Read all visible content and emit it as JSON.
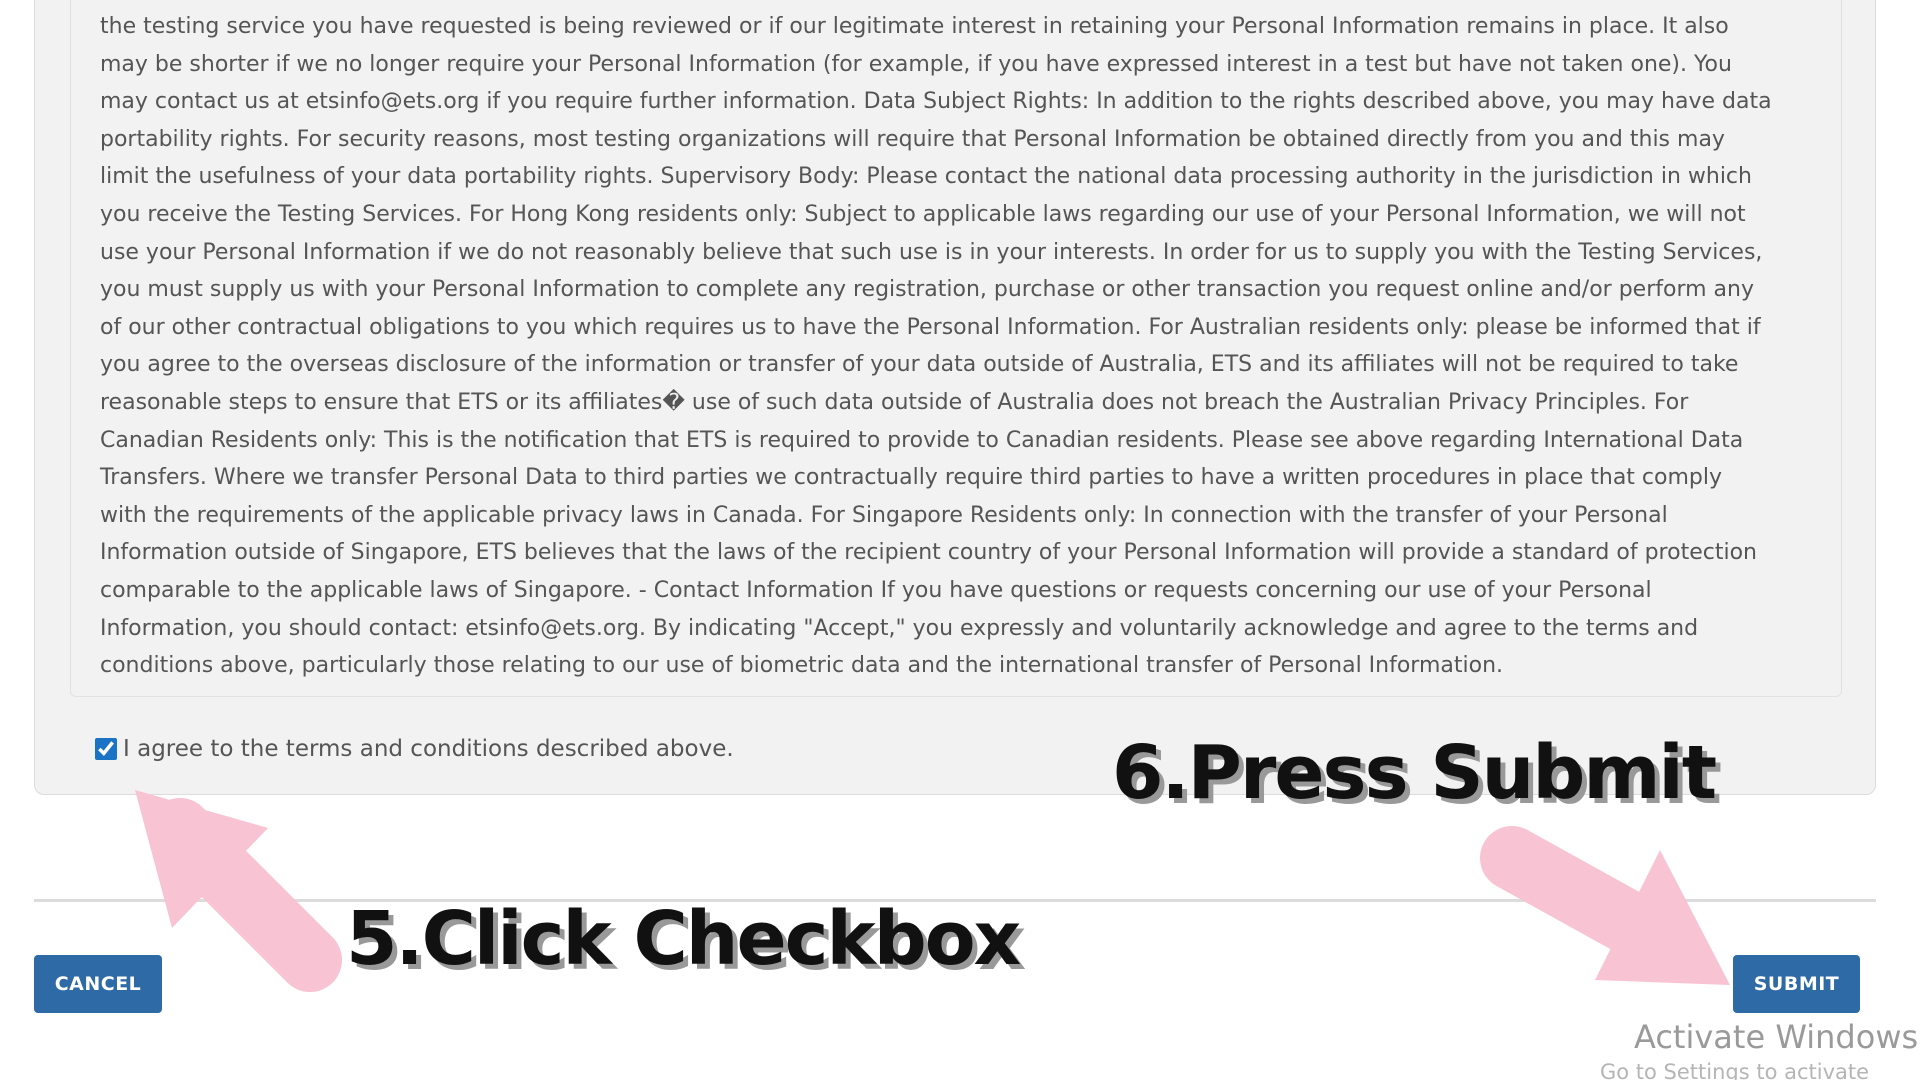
{
  "terms": {
    "text": "the testing service you have requested is being reviewed or if our legitimate interest in retaining your Personal Information remains in place. It also\nmay be shorter if we no longer require your Personal Information (for example, if you have expressed interest in a test but have not taken one). You\nmay contact us at etsinfo@ets.org if you require further information. Data Subject Rights: In addition to the rights described above, you may have data\nportability rights. For security reasons, most testing organizations will require that Personal Information be obtained directly from you and this may\nlimit the usefulness of your data portability rights. Supervisory Body: Please contact the national data processing authority in the jurisdiction in which\nyou receive the Testing Services. For Hong Kong residents only: Subject to applicable laws regarding our use of your Personal Information, we will not\nuse your Personal Information if we do not reasonably believe that such use is in your interests. In order for us to supply you with the Testing Services,\nyou must supply us with your Personal Information to complete any registration, purchase or other transaction you request online and/or perform any\nof our other contractual obligations to you which requires us to have the Personal Information. For Australian residents only: please be informed that if\nyou agree to the overseas disclosure of the information or transfer of your data outside of Australia, ETS and its affiliates will not be required to take\nreasonable steps to ensure that ETS or its affiliates� use of such data outside of Australia does not breach the Australian Privacy Principles. For\nCanadian Residents only: This is the notification that ETS is required to provide to Canadian residents. Please see above regarding International Data\nTransfers. Where we transfer Personal Data to third parties we contractually require third parties to have a written procedures in place that comply\nwith the requirements of the applicable privacy laws in Canada. For Singapore Residents only: In connection with the transfer of your Personal\nInformation outside of Singapore, ETS believes that the laws of the recipient country of your Personal Information will provide a standard of protection\ncomparable to the applicable laws of Singapore. - Contact Information If you have questions or requests concerning our use of your Personal\nInformation, you should contact: etsinfo@ets.org. By indicating \"Accept,\" you expressly and voluntarily acknowledge and agree to the terms and\nconditions above, particularly those relating to our use of biometric data and the international transfer of Personal Information."
  },
  "agreement": {
    "checked": true,
    "label": "I agree to the terms and conditions described above."
  },
  "buttons": {
    "cancel_label": "CANCEL",
    "submit_label": "SUBMIT"
  },
  "annotations": {
    "step5": "5.Click Checkbox",
    "step6": "6.Press Submit",
    "arrow_color": "#f8c3d3"
  },
  "colors": {
    "button": "#2d6aa6",
    "checkbox_accent": "#1a73c4"
  },
  "watermark": {
    "title": "Activate Windows",
    "subtitle": "Go to Settings to activate"
  }
}
